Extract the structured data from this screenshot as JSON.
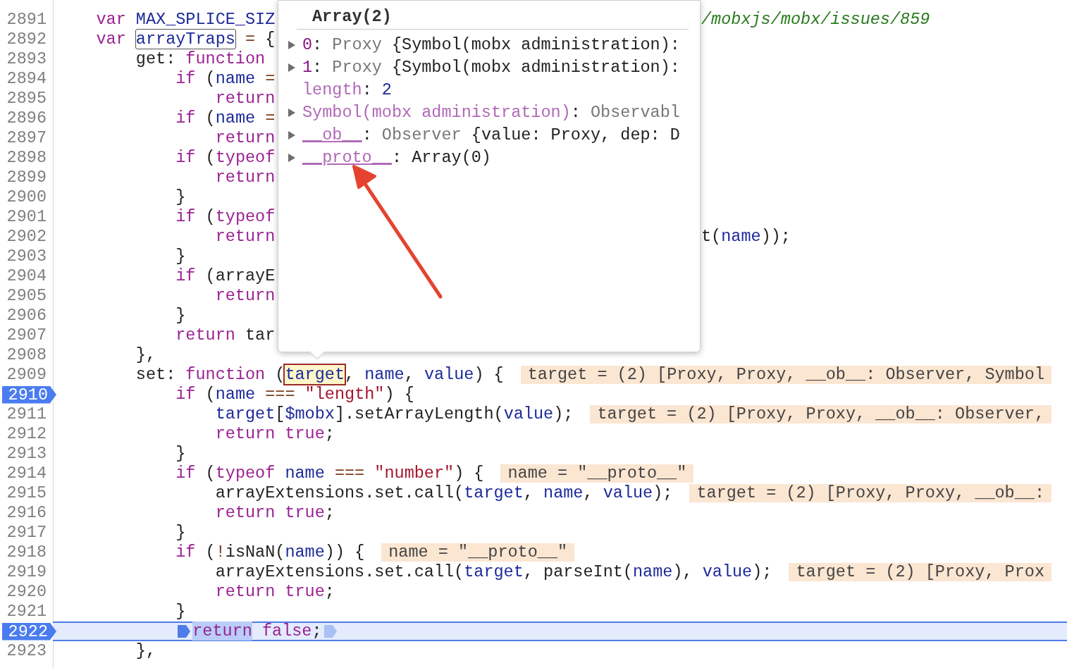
{
  "editor": {
    "lines": [
      {
        "number": "2891",
        "breakpoint": false,
        "current": false,
        "segments": [
          {
            "kind": "code",
            "tokens": [
              {
                "kind": "keyword",
                "text": "    var"
              },
              {
                "kind": "def",
                "text": " MAX_SPLICE_SIZ"
              }
            ]
          }
        ],
        "right": [
          {
            "kind": "comment",
            "text": "/mobxjs/mobx/issues/859"
          }
        ]
      },
      {
        "number": "2892",
        "breakpoint": false,
        "current": false,
        "segments": [
          {
            "kind": "code",
            "tokens": [
              {
                "kind": "keyword",
                "text": "    var "
              },
              {
                "kind": "selected",
                "text": "arrayTraps"
              },
              {
                "kind": "operator",
                "text": " ="
              },
              {
                "kind": "plain",
                "text": " {"
              }
            ]
          }
        ]
      },
      {
        "number": "2893",
        "breakpoint": false,
        "current": false,
        "segments": [
          {
            "kind": "code",
            "tokens": [
              {
                "kind": "plain",
                "text": "        get: "
              },
              {
                "kind": "keyword",
                "text": "function"
              }
            ]
          }
        ]
      },
      {
        "number": "2894",
        "breakpoint": false,
        "current": false,
        "segments": [
          {
            "kind": "code",
            "tokens": [
              {
                "kind": "keyword",
                "text": "            if"
              },
              {
                "kind": "plain",
                "text": " ("
              },
              {
                "kind": "def",
                "text": "name"
              },
              {
                "kind": "operator",
                "text": " ="
              }
            ]
          }
        ]
      },
      {
        "number": "2895",
        "breakpoint": false,
        "current": false,
        "segments": [
          {
            "kind": "code",
            "tokens": [
              {
                "kind": "keyword",
                "text": "                return"
              }
            ]
          }
        ]
      },
      {
        "number": "2896",
        "breakpoint": false,
        "current": false,
        "segments": [
          {
            "kind": "code",
            "tokens": [
              {
                "kind": "keyword",
                "text": "            if"
              },
              {
                "kind": "plain",
                "text": " ("
              },
              {
                "kind": "def",
                "text": "name"
              },
              {
                "kind": "operator",
                "text": " ="
              }
            ]
          }
        ]
      },
      {
        "number": "2897",
        "breakpoint": false,
        "current": false,
        "segments": [
          {
            "kind": "code",
            "tokens": [
              {
                "kind": "keyword",
                "text": "                return"
              }
            ]
          }
        ]
      },
      {
        "number": "2898",
        "breakpoint": false,
        "current": false,
        "segments": [
          {
            "kind": "code",
            "tokens": [
              {
                "kind": "keyword",
                "text": "            if"
              },
              {
                "kind": "plain",
                "text": " ("
              },
              {
                "kind": "keyword",
                "text": "typeof"
              }
            ]
          }
        ]
      },
      {
        "number": "2899",
        "breakpoint": false,
        "current": false,
        "segments": [
          {
            "kind": "code",
            "tokens": [
              {
                "kind": "keyword",
                "text": "                return"
              }
            ]
          }
        ]
      },
      {
        "number": "2900",
        "breakpoint": false,
        "current": false,
        "segments": [
          {
            "kind": "code",
            "tokens": [
              {
                "kind": "plain",
                "text": "            }"
              }
            ]
          }
        ]
      },
      {
        "number": "2901",
        "breakpoint": false,
        "current": false,
        "segments": [
          {
            "kind": "code",
            "tokens": [
              {
                "kind": "keyword",
                "text": "            if"
              },
              {
                "kind": "plain",
                "text": " ("
              },
              {
                "kind": "keyword",
                "text": "typeof"
              }
            ]
          }
        ]
      },
      {
        "number": "2902",
        "breakpoint": false,
        "current": false,
        "segments": [
          {
            "kind": "code",
            "tokens": [
              {
                "kind": "keyword",
                "text": "                return"
              }
            ]
          }
        ],
        "right": [
          {
            "kind": "plain",
            "text": "t("
          },
          {
            "kind": "def",
            "text": "name"
          },
          {
            "kind": "plain",
            "text": "));"
          }
        ]
      },
      {
        "number": "2903",
        "breakpoint": false,
        "current": false,
        "segments": [
          {
            "kind": "code",
            "tokens": [
              {
                "kind": "plain",
                "text": "            }"
              }
            ]
          }
        ]
      },
      {
        "number": "2904",
        "breakpoint": false,
        "current": false,
        "segments": [
          {
            "kind": "code",
            "tokens": [
              {
                "kind": "keyword",
                "text": "            if"
              },
              {
                "kind": "plain",
                "text": " (arrayE"
              }
            ]
          }
        ]
      },
      {
        "number": "2905",
        "breakpoint": false,
        "current": false,
        "segments": [
          {
            "kind": "code",
            "tokens": [
              {
                "kind": "keyword",
                "text": "                return"
              }
            ]
          }
        ]
      },
      {
        "number": "2906",
        "breakpoint": false,
        "current": false,
        "segments": [
          {
            "kind": "code",
            "tokens": [
              {
                "kind": "plain",
                "text": "            }"
              }
            ]
          }
        ]
      },
      {
        "number": "2907",
        "breakpoint": false,
        "current": false,
        "segments": [
          {
            "kind": "code",
            "tokens": [
              {
                "kind": "keyword",
                "text": "            return"
              },
              {
                "kind": "plain",
                "text": " tar"
              }
            ]
          }
        ]
      },
      {
        "number": "2908",
        "breakpoint": false,
        "current": false,
        "segments": [
          {
            "kind": "code",
            "tokens": [
              {
                "kind": "plain",
                "text": "        },"
              }
            ]
          }
        ]
      },
      {
        "number": "2909",
        "breakpoint": false,
        "current": false,
        "segments": [
          {
            "kind": "code",
            "tokens": [
              {
                "kind": "plain",
                "text": "        set: "
              },
              {
                "kind": "keyword",
                "text": "function"
              },
              {
                "kind": "plain",
                "text": " ("
              },
              {
                "kind": "hover",
                "text": "target"
              },
              {
                "kind": "plain",
                "text": ", "
              },
              {
                "kind": "def",
                "text": "name"
              },
              {
                "kind": "plain",
                "text": ", "
              },
              {
                "kind": "def",
                "text": "value"
              },
              {
                "kind": "plain",
                "text": ") {"
              }
            ]
          },
          {
            "kind": "value",
            "text": "target = (2) [Proxy, Proxy, __ob__: Observer, Symbol"
          }
        ]
      },
      {
        "number": "2910",
        "breakpoint": true,
        "current": false,
        "segments": [
          {
            "kind": "code",
            "tokens": [
              {
                "kind": "keyword",
                "text": "            if"
              },
              {
                "kind": "plain",
                "text": " ("
              },
              {
                "kind": "def",
                "text": "name"
              },
              {
                "kind": "operator",
                "text": " ==="
              },
              {
                "kind": "string",
                "text": " \"length\""
              },
              {
                "kind": "plain",
                "text": ") {"
              }
            ]
          }
        ]
      },
      {
        "number": "2911",
        "breakpoint": false,
        "current": false,
        "segments": [
          {
            "kind": "code",
            "tokens": [
              {
                "kind": "def",
                "text": "                target"
              },
              {
                "kind": "plain",
                "text": "["
              },
              {
                "kind": "def",
                "text": "$mobx"
              },
              {
                "kind": "plain",
                "text": "].setArrayLength("
              },
              {
                "kind": "def",
                "text": "value"
              },
              {
                "kind": "plain",
                "text": ");"
              }
            ]
          },
          {
            "kind": "value",
            "text": "target = (2) [Proxy, Proxy, __ob__: Observer,"
          }
        ]
      },
      {
        "number": "2912",
        "breakpoint": false,
        "current": false,
        "segments": [
          {
            "kind": "code",
            "tokens": [
              {
                "kind": "keyword",
                "text": "                return"
              },
              {
                "kind": "keyword",
                "text": " true"
              },
              {
                "kind": "plain",
                "text": ";"
              }
            ]
          }
        ]
      },
      {
        "number": "2913",
        "breakpoint": false,
        "current": false,
        "segments": [
          {
            "kind": "code",
            "tokens": [
              {
                "kind": "plain",
                "text": "            }"
              }
            ]
          }
        ]
      },
      {
        "number": "2914",
        "breakpoint": false,
        "current": false,
        "segments": [
          {
            "kind": "code",
            "tokens": [
              {
                "kind": "keyword",
                "text": "            if"
              },
              {
                "kind": "plain",
                "text": " ("
              },
              {
                "kind": "keyword",
                "text": "typeof"
              },
              {
                "kind": "def",
                "text": " name"
              },
              {
                "kind": "operator",
                "text": " ==="
              },
              {
                "kind": "string",
                "text": " \"number\""
              },
              {
                "kind": "plain",
                "text": ") {"
              }
            ]
          },
          {
            "kind": "value",
            "text": "name = \"__proto__\""
          }
        ]
      },
      {
        "number": "2915",
        "breakpoint": false,
        "current": false,
        "segments": [
          {
            "kind": "code",
            "tokens": [
              {
                "kind": "plain",
                "text": "                arrayExtensions.set.call("
              },
              {
                "kind": "def",
                "text": "target"
              },
              {
                "kind": "plain",
                "text": ", "
              },
              {
                "kind": "def",
                "text": "name"
              },
              {
                "kind": "plain",
                "text": ", "
              },
              {
                "kind": "def",
                "text": "value"
              },
              {
                "kind": "plain",
                "text": ");"
              }
            ]
          },
          {
            "kind": "value",
            "text": "target = (2) [Proxy, Proxy, __ob__:"
          }
        ]
      },
      {
        "number": "2916",
        "breakpoint": false,
        "current": false,
        "segments": [
          {
            "kind": "code",
            "tokens": [
              {
                "kind": "keyword",
                "text": "                return"
              },
              {
                "kind": "keyword",
                "text": " true"
              },
              {
                "kind": "plain",
                "text": ";"
              }
            ]
          }
        ]
      },
      {
        "number": "2917",
        "breakpoint": false,
        "current": false,
        "segments": [
          {
            "kind": "code",
            "tokens": [
              {
                "kind": "plain",
                "text": "            }"
              }
            ]
          }
        ]
      },
      {
        "number": "2918",
        "breakpoint": false,
        "current": false,
        "segments": [
          {
            "kind": "code",
            "tokens": [
              {
                "kind": "keyword",
                "text": "            if"
              },
              {
                "kind": "plain",
                "text": " ("
              },
              {
                "kind": "operator",
                "text": "!"
              },
              {
                "kind": "plain",
                "text": "isNaN("
              },
              {
                "kind": "def",
                "text": "name"
              },
              {
                "kind": "plain",
                "text": ")) {"
              }
            ]
          },
          {
            "kind": "value",
            "text": "name = \"__proto__\""
          }
        ]
      },
      {
        "number": "2919",
        "breakpoint": false,
        "current": false,
        "segments": [
          {
            "kind": "code",
            "tokens": [
              {
                "kind": "plain",
                "text": "                arrayExtensions.set.call("
              },
              {
                "kind": "def",
                "text": "target"
              },
              {
                "kind": "plain",
                "text": ", parseInt("
              },
              {
                "kind": "def",
                "text": "name"
              },
              {
                "kind": "plain",
                "text": "), "
              },
              {
                "kind": "def",
                "text": "value"
              },
              {
                "kind": "plain",
                "text": ");"
              }
            ]
          },
          {
            "kind": "value",
            "text": "target = (2) [Proxy, Prox"
          }
        ]
      },
      {
        "number": "2920",
        "breakpoint": false,
        "current": false,
        "segments": [
          {
            "kind": "code",
            "tokens": [
              {
                "kind": "keyword",
                "text": "                return"
              },
              {
                "kind": "keyword",
                "text": " true"
              },
              {
                "kind": "plain",
                "text": ";"
              }
            ]
          }
        ]
      },
      {
        "number": "2921",
        "breakpoint": false,
        "current": false,
        "segments": [
          {
            "kind": "code",
            "tokens": [
              {
                "kind": "plain",
                "text": "            }"
              }
            ]
          }
        ]
      },
      {
        "number": "2922",
        "breakpoint": true,
        "current": true,
        "segments": [
          {
            "kind": "breakpoint",
            "active": true
          },
          {
            "kind": "code",
            "tokens": [
              {
                "kind": "exec",
                "text": "            return"
              },
              {
                "kind": "keyword",
                "text": " false"
              },
              {
                "kind": "plain",
                "text": ";"
              }
            ]
          },
          {
            "kind": "breakpoint",
            "active": false
          }
        ]
      },
      {
        "number": "2923",
        "breakpoint": false,
        "current": false,
        "segments": [
          {
            "kind": "code",
            "tokens": [
              {
                "kind": "plain",
                "text": "        },"
              }
            ]
          }
        ]
      }
    ]
  },
  "popover": {
    "title": "Array(2)",
    "rows": [
      {
        "expandable": true,
        "tokens": [
          {
            "kind": "index",
            "text": "0"
          },
          {
            "kind": "plain",
            "text": ": "
          },
          {
            "kind": "dim",
            "text": "Proxy"
          },
          {
            "kind": "plain",
            "text": " {Symbol(mobx administration):"
          }
        ]
      },
      {
        "expandable": true,
        "tokens": [
          {
            "kind": "index",
            "text": "1"
          },
          {
            "kind": "plain",
            "text": ": "
          },
          {
            "kind": "dim",
            "text": "Proxy"
          },
          {
            "kind": "plain",
            "text": " {Symbol(mobx administration):"
          }
        ]
      },
      {
        "expandable": false,
        "tokens": [
          {
            "kind": "meta",
            "text": "length"
          },
          {
            "kind": "plain",
            "text": ": "
          },
          {
            "kind": "number",
            "text": "2"
          }
        ]
      },
      {
        "expandable": true,
        "tokens": [
          {
            "kind": "meta",
            "text": "Symbol(mobx administration)"
          },
          {
            "kind": "plain",
            "text": ": "
          },
          {
            "kind": "dim",
            "text": "Observabl"
          }
        ]
      },
      {
        "expandable": true,
        "tokens": [
          {
            "kind": "meta",
            "text": "__ob__"
          },
          {
            "kind": "plain",
            "text": ": "
          },
          {
            "kind": "dim",
            "text": "Observer"
          },
          {
            "kind": "plain",
            "text": " {value: Proxy, dep: D"
          }
        ]
      },
      {
        "expandable": true,
        "tokens": [
          {
            "kind": "meta",
            "text": "__proto__"
          },
          {
            "kind": "plain",
            "text": ": Array(0)"
          }
        ]
      }
    ]
  }
}
